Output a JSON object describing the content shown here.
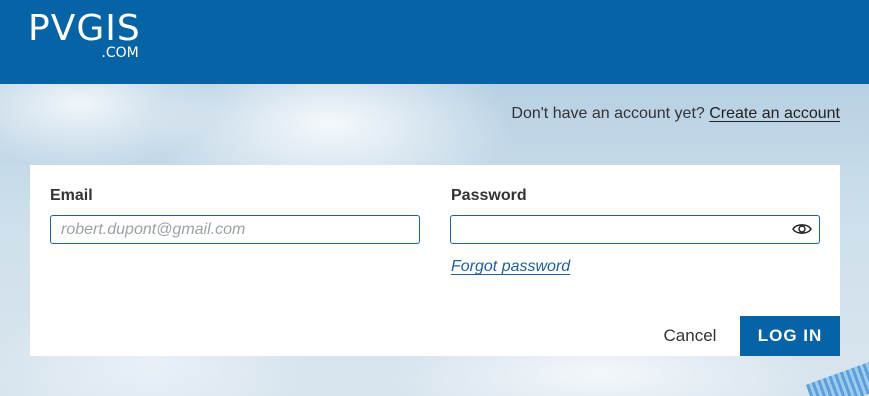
{
  "header": {
    "logo_main": "PVGIS",
    "logo_sub": ".COM",
    "background_color": "#0563a6"
  },
  "signup": {
    "prompt": "Don't have an account yet?",
    "link": "Create an account"
  },
  "form": {
    "email_label": "Email",
    "email_placeholder": "robert.dupont@gmail.com",
    "email_value": "",
    "password_label": "Password",
    "password_value": "",
    "password_toggle_icon": "eye-icon",
    "forgot_link": "Forgot password",
    "cancel_label": "Cancel",
    "login_label": "LOG IN"
  },
  "colors": {
    "brand": "#0563a6",
    "link": "#1f5f9e"
  }
}
